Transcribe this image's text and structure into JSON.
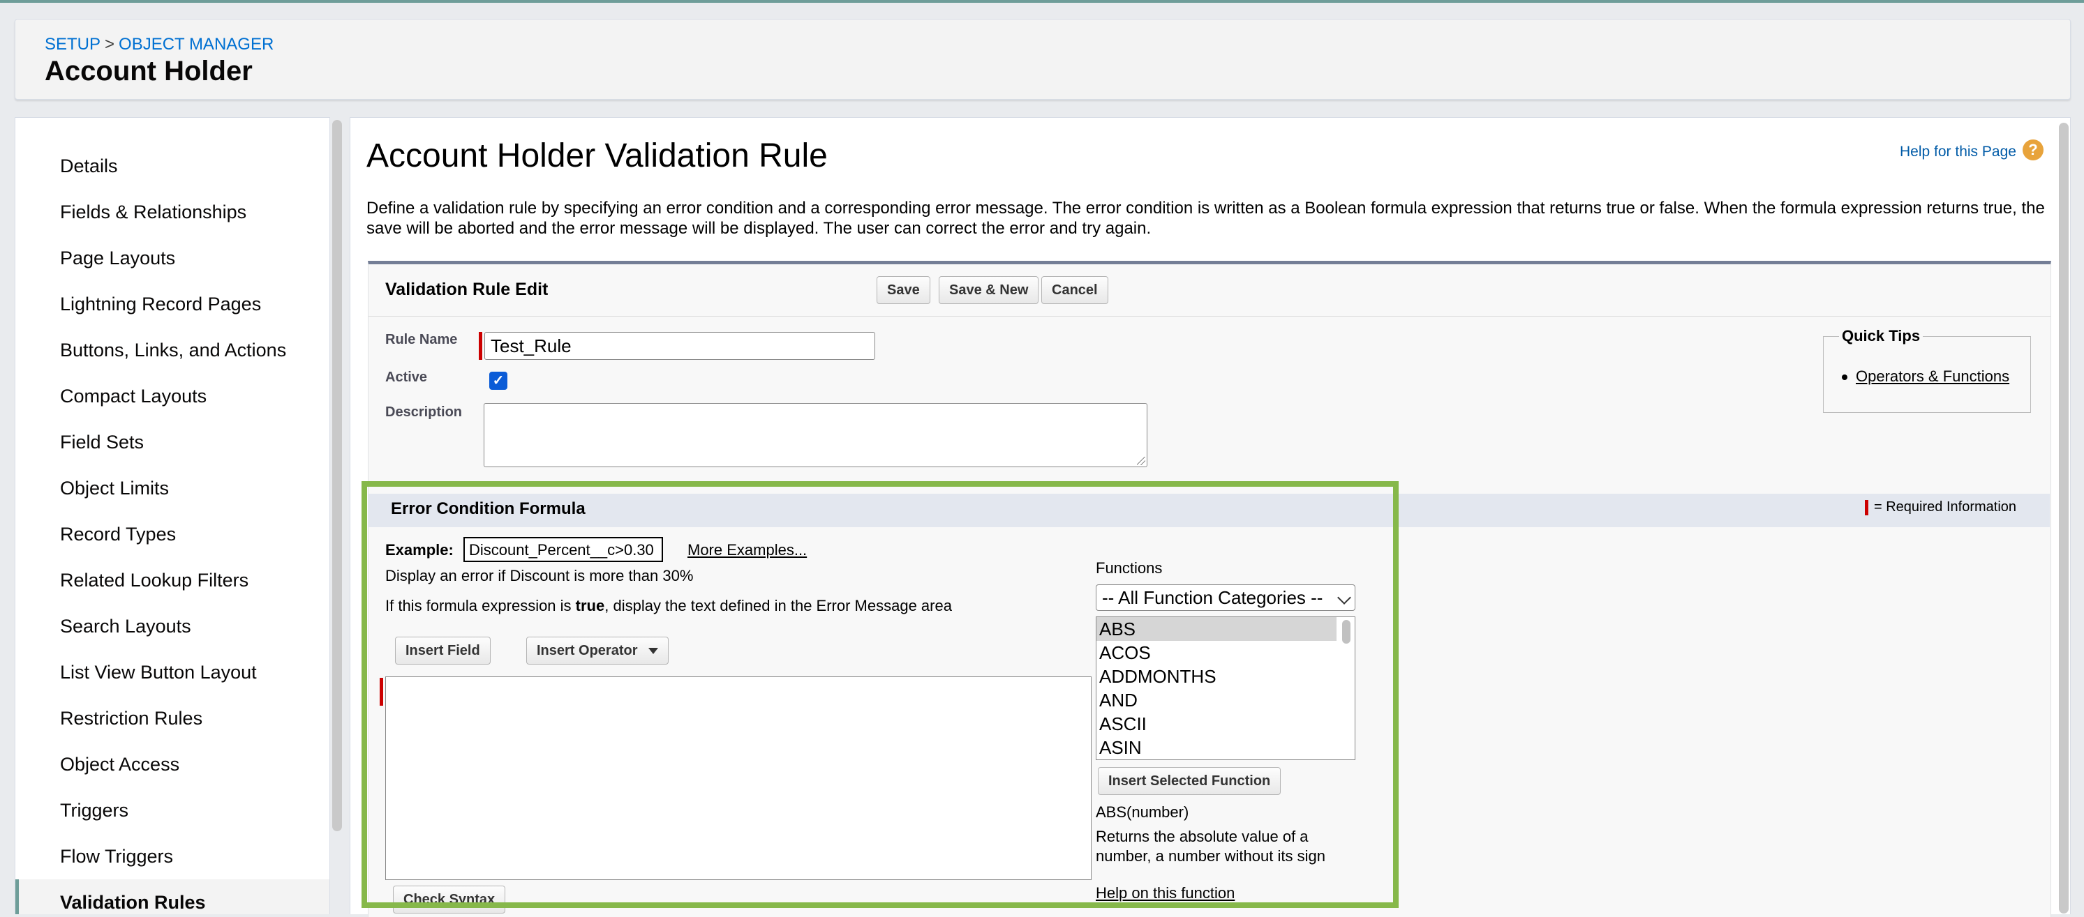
{
  "header": {
    "breadcrumb": [
      "SETUP",
      ">",
      "OBJECT MANAGER"
    ],
    "title": "Account Holder"
  },
  "sidebar": {
    "items": [
      "Details",
      "Fields & Relationships",
      "Page Layouts",
      "Lightning Record Pages",
      "Buttons, Links, and Actions",
      "Compact Layouts",
      "Field Sets",
      "Object Limits",
      "Record Types",
      "Related Lookup Filters",
      "Search Layouts",
      "List View Button Layout",
      "Restriction Rules",
      "Object Access",
      "Triggers",
      "Flow Triggers",
      "Validation Rules"
    ],
    "active": "Validation Rules"
  },
  "main": {
    "title": "Account Holder Validation Rule",
    "help_link": "Help for this Page",
    "help_icon": "question-icon",
    "intro": "Define a validation rule by specifying an error condition and a corresponding error message. The error condition is written as a Boolean formula expression that returns true or false. When the formula expression returns true, the save will be aborted and the error message will be displayed. The user can correct the error and try again."
  },
  "edit": {
    "title": "Validation Rule Edit",
    "buttons": {
      "save": "Save",
      "save_new": "Save & New",
      "cancel": "Cancel"
    },
    "rule_name_label": "Rule Name",
    "rule_name_value": "Test_Rule",
    "active_label": "Active",
    "active_checked": true,
    "description_label": "Description",
    "description_value": ""
  },
  "quick_tips": {
    "title": "Quick Tips",
    "items": [
      "Operators & Functions"
    ]
  },
  "formula": {
    "title": "Error Condition Formula",
    "required_info": "= Required Information",
    "example_label": "Example:",
    "example_value": "Discount_Percent__c>0.30",
    "more_examples": "More Examples...",
    "example_desc": "Display an error if Discount is more than 30%",
    "hint_prefix": "If this formula expression is ",
    "hint_bold": "true",
    "hint_suffix": ", display the text defined in the Error Message area",
    "insert_field": "Insert Field",
    "insert_operator": "Insert Operator",
    "check_syntax": "Check Syntax",
    "value": ""
  },
  "functions": {
    "label": "Functions",
    "category_selected": "-- All Function Categories --",
    "list": [
      "ABS",
      "ACOS",
      "ADDMONTHS",
      "AND",
      "ASCII",
      "ASIN"
    ],
    "selected": "ABS",
    "insert_selected": "Insert Selected Function",
    "signature": "ABS(number)",
    "description": "Returns the absolute value of a number, a number without its sign",
    "help": "Help on this function"
  },
  "colors": {
    "highlight_frame": "#86b84a",
    "link_blue": "#0070d2",
    "required_red": "#cc0000",
    "checkbox_blue": "#0b5cd7"
  }
}
